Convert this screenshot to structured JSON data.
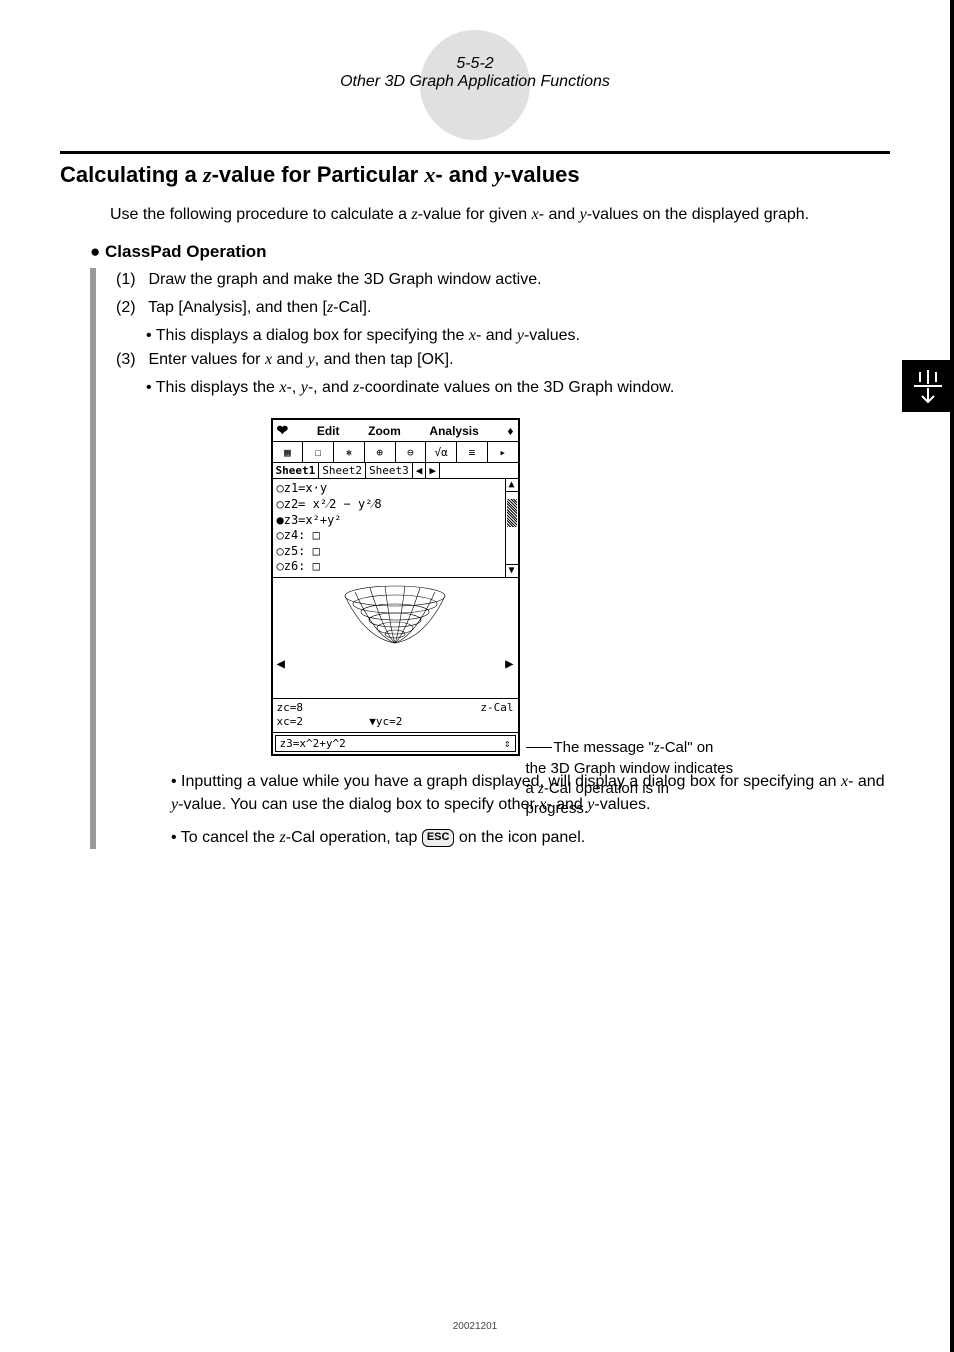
{
  "header": {
    "page_number": "5-5-2",
    "title": "Other 3D Graph Application Functions"
  },
  "section": {
    "heading_prefix": "Calculating a ",
    "heading_var1": "z",
    "heading_mid1": "-value for Particular ",
    "heading_var2": "x",
    "heading_mid2": "- and ",
    "heading_var3": "y",
    "heading_suffix": "-values",
    "intro_prefix": "Use the following procedure to calculate a ",
    "intro_var1": "z",
    "intro_mid1": "-value for given ",
    "intro_var2": "x",
    "intro_mid2": "- and ",
    "intro_var3": "y",
    "intro_suffix": "-values on the displayed graph."
  },
  "operation": {
    "bullet": "●",
    "heading": " ClassPad Operation",
    "step1_num": "(1)",
    "step1_text": "Draw the graph and make the 3D Graph window active.",
    "step2_num": "(2)",
    "step2_prefix": "Tap [Analysis], and then [",
    "step2_var": "z",
    "step2_suffix": "-Cal].",
    "step2_sub_prefix": "This displays a dialog box for specifying the ",
    "step2_sub_var1": "x",
    "step2_sub_mid": "- and ",
    "step2_sub_var2": "y",
    "step2_sub_suffix": "-values.",
    "step3_num": "(3)",
    "step3_prefix": "Enter values for ",
    "step3_var1": "x",
    "step3_mid": " and ",
    "step3_var2": "y",
    "step3_suffix": ", and then tap [OK].",
    "step3_sub_prefix": "This displays the ",
    "step3_sub_var1": "x",
    "step3_sub_mid1": "-, ",
    "step3_sub_var2": "y",
    "step3_sub_mid2": "-, and ",
    "step3_sub_var3": "z",
    "step3_sub_suffix": "-coordinate values on the 3D Graph window."
  },
  "device": {
    "menu": {
      "edit": "Edit",
      "zoom": "Zoom",
      "analysis": "Analysis"
    },
    "toolbar": {
      "b1": "▦",
      "b2": "☐",
      "b3": "⎈",
      "b4": "⊕",
      "b5": "⊖",
      "b6": "√α",
      "b7": "≡",
      "b8": "▸"
    },
    "tabs": {
      "s1": "Sheet1",
      "s2": "Sheet2",
      "s3": "Sheet3"
    },
    "equations": {
      "z1": "○z1=x·y",
      "z2": "○z2= x²⁄2 − y²⁄8",
      "z3": "●z3=x²+y²",
      "z4": "○z4: □",
      "z5": "○z5: □",
      "z6": "○z6: □"
    },
    "status": {
      "zc": "zc=8",
      "xc": "xc=2",
      "yc": "▼yc=2",
      "zcal": "z-Cal"
    },
    "formula": "z3=x^2+y^2"
  },
  "annotation": {
    "line1_prefix": "The message \"",
    "line1_var": "z",
    "line1_suffix": "-Cal\" on the 3D Graph window indicates a ",
    "line2_var": "z",
    "line2_suffix": "-Cal operation is in progress."
  },
  "post": {
    "p1_prefix": "Inputting a value while you have a graph displayed, will display a dialog box for specifying an ",
    "p1_var1": "x",
    "p1_mid1": "- and ",
    "p1_var2": "y",
    "p1_mid2": "-value. You can use the dialog box to specify other ",
    "p1_var3": "x",
    "p1_mid3": "- and ",
    "p1_var4": "y",
    "p1_suffix": "-values.",
    "p2_prefix": "To cancel the ",
    "p2_var": "z",
    "p2_mid": "-Cal operation, tap ",
    "p2_button": "ESC",
    "p2_suffix": " on the icon panel."
  },
  "footer": {
    "id": "20021201"
  }
}
